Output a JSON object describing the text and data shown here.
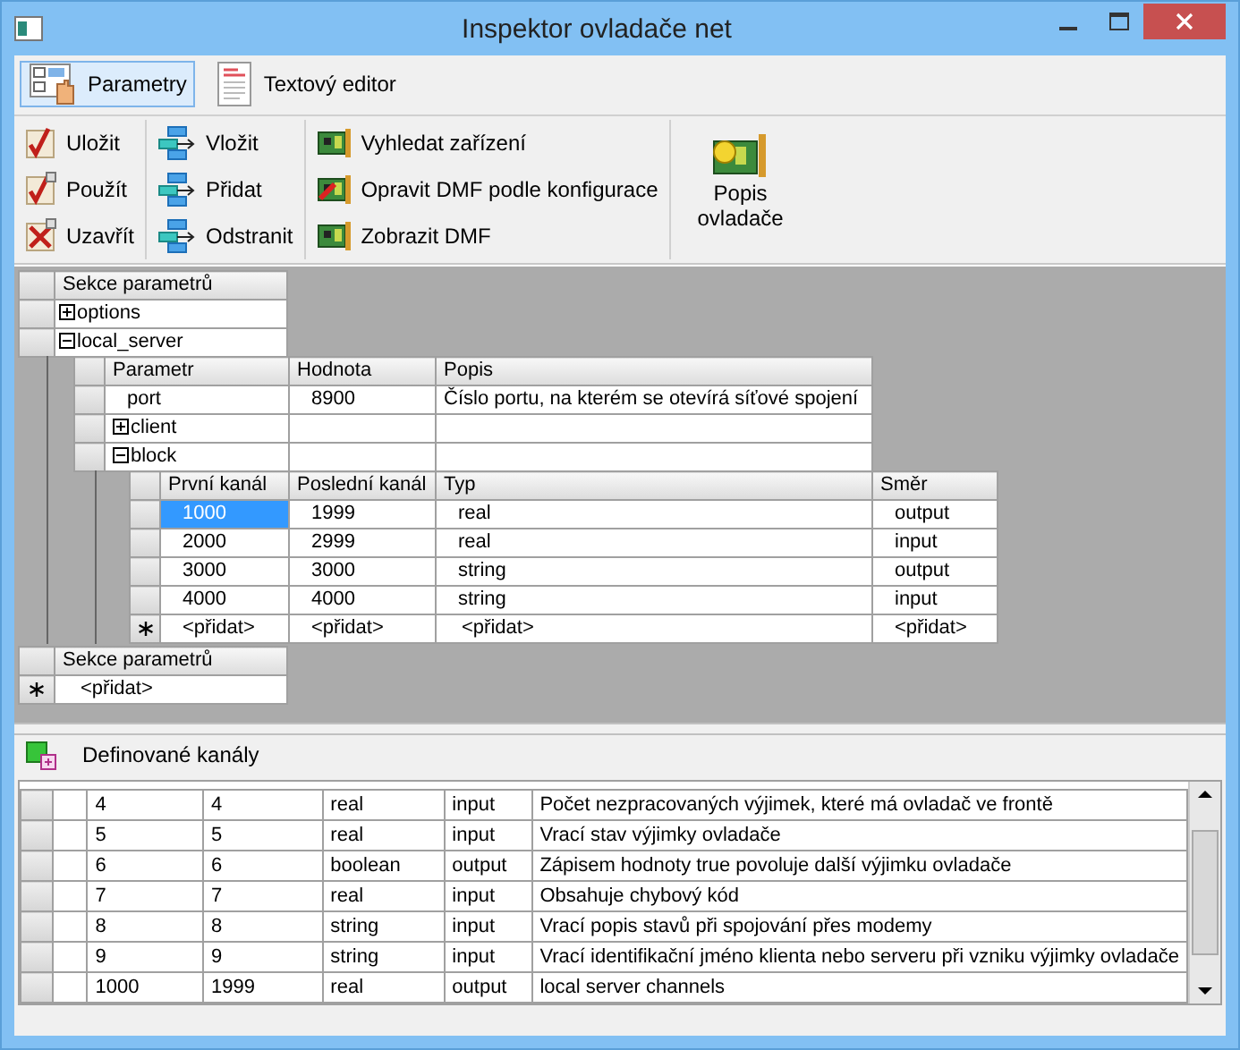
{
  "window": {
    "title": "Inspektor ovladače net"
  },
  "tabs": [
    {
      "label": "Parametry",
      "selected": true
    },
    {
      "label": "Textový editor",
      "selected": false
    }
  ],
  "toolbar": {
    "groups": [
      [
        "Uložit",
        "Použít",
        "Uzavřít"
      ],
      [
        "Vložit",
        "Přidat",
        "Odstranit"
      ],
      [
        "Vyhledat zařízení",
        "Opravit DMF podle konfigurace",
        "Zobrazit DMF"
      ]
    ],
    "large_button": "Popis ovladače"
  },
  "sections": {
    "header": "Sekce parametrů",
    "rows": [
      {
        "label": "options",
        "expanded": false
      },
      {
        "label": "local_server",
        "expanded": true,
        "table": {
          "columns": [
            "Parametr",
            "Hodnota",
            "Popis"
          ],
          "rows": [
            {
              "kind": "value",
              "cells": [
                "port",
                "8900",
                "Číslo portu, na kterém se otevírá síťové spojení"
              ]
            },
            {
              "kind": "node",
              "label": "client",
              "expanded": false
            },
            {
              "kind": "node",
              "label": "block",
              "expanded": true,
              "table": {
                "columns": [
                  "První kanál",
                  "Poslední kanál",
                  "Typ",
                  "Směr"
                ],
                "rows": [
                  {
                    "cells": [
                      "1000",
                      "1999",
                      "real",
                      "output"
                    ],
                    "selected": true
                  },
                  {
                    "cells": [
                      "2000",
                      "2999",
                      "real",
                      "input"
                    ],
                    "selected": false
                  },
                  {
                    "cells": [
                      "3000",
                      "3000",
                      "string",
                      "output"
                    ],
                    "selected": false
                  },
                  {
                    "cells": [
                      "4000",
                      "4000",
                      "string",
                      "input"
                    ],
                    "selected": false
                  }
                ],
                "add_row": [
                  "<přidat>",
                  "<přidat>",
                  "<přidat>",
                  "<přidat>"
                ]
              }
            }
          ]
        }
      }
    ]
  },
  "new_section": {
    "header": "Sekce parametrů",
    "placeholder": "<přidat>"
  },
  "channels_panel": {
    "title": "Definované kanály",
    "rows": [
      {
        "cells": [
          "4",
          "4",
          "real",
          "input",
          "Počet nezpracovaných výjimek, které má ovladač ve frontě"
        ]
      },
      {
        "cells": [
          "5",
          "5",
          "real",
          "input",
          "Vrací stav výjimky ovladače"
        ]
      },
      {
        "cells": [
          "6",
          "6",
          "boolean",
          "output",
          "Zápisem hodnoty true povoluje další výjimku ovladače"
        ]
      },
      {
        "cells": [
          "7",
          "7",
          "real",
          "input",
          "Obsahuje chybový kód"
        ]
      },
      {
        "cells": [
          "8",
          "8",
          "string",
          "input",
          "Vrací popis stavů při spojování přes modemy"
        ]
      },
      {
        "cells": [
          "9",
          "9",
          "string",
          "input",
          "Vrací identifikační jméno klienta nebo serveru při vzniku výjimky ovladače"
        ]
      },
      {
        "cells": [
          "1000",
          "1999",
          "real",
          "output",
          "local server channels"
        ]
      }
    ]
  }
}
